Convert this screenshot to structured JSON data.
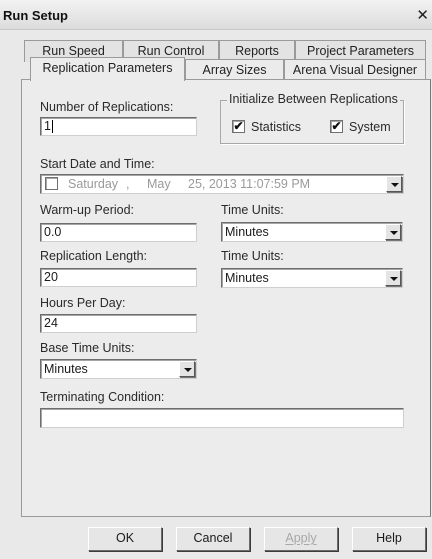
{
  "window": {
    "title": "Run Setup",
    "close_glyph": "✕"
  },
  "tabs": {
    "back_row": [
      "Run Speed",
      "Run Control",
      "Reports",
      "Project Parameters"
    ],
    "front_row": [
      "Replication Parameters",
      "Array Sizes",
      "Arena Visual Designer"
    ],
    "active": "Replication Parameters"
  },
  "form": {
    "num_replications": {
      "label": "Number of Replications:",
      "value": "1"
    },
    "init_group": {
      "title": "Initialize Between Replications",
      "statistics": {
        "label": "Statistics",
        "checked": true
      },
      "system": {
        "label": "System",
        "checked": true
      }
    },
    "start_datetime": {
      "label": "Start Date and Time:",
      "checked": false,
      "day": "Saturday",
      "sep": ",",
      "month": "May",
      "rest": "25, 2013 11:07:59 PM"
    },
    "warmup": {
      "label": "Warm-up Period:",
      "value": "0.0"
    },
    "warmup_units": {
      "label": "Time Units:",
      "value": "Minutes"
    },
    "rep_length": {
      "label": "Replication Length:",
      "value": "20"
    },
    "rep_length_units": {
      "label": "Time Units:",
      "value": "Minutes"
    },
    "hours_per_day": {
      "label": "Hours Per Day:",
      "value": "24"
    },
    "base_time_units": {
      "label": "Base Time Units:",
      "value": "Minutes"
    },
    "terminating": {
      "label": "Terminating Condition:",
      "value": ""
    }
  },
  "buttons": {
    "ok": "OK",
    "cancel": "Cancel",
    "apply": "Apply",
    "help": "Help"
  },
  "icons": {
    "checkbox_check": "✔",
    "dropdown": "chevron-down-icon"
  }
}
